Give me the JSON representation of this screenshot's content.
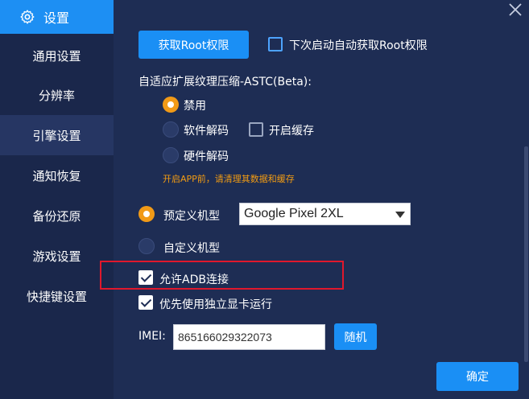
{
  "sidebar": {
    "title": "设置",
    "items": [
      {
        "label": "通用设置"
      },
      {
        "label": "分辨率"
      },
      {
        "label": "引擎设置"
      },
      {
        "label": "通知恢复"
      },
      {
        "label": "备份还原"
      },
      {
        "label": "游戏设置"
      },
      {
        "label": "快捷键设置"
      }
    ],
    "active_item": "引擎设置"
  },
  "root": {
    "button_label": "获取Root权限",
    "auto_checkbox_label": "下次启动自动获取Root权限",
    "auto_checked": false
  },
  "astc": {
    "title": "自适应扩展纹理压缩-ASTC(Beta):",
    "options": [
      {
        "label": "禁用",
        "selected": true
      },
      {
        "label": "软件解码",
        "selected": false
      },
      {
        "label": "硬件解码",
        "selected": false
      }
    ],
    "cache_label": "开启缓存",
    "cache_checked": false,
    "hint": "开启APP前，请清理其数据和缓存"
  },
  "model": {
    "preset_label": "预定义机型",
    "preset_selected": true,
    "preset_value": "Google Pixel 2XL",
    "custom_label": "自定义机型",
    "custom_selected": false
  },
  "adb": {
    "label": "允许ADB连接",
    "checked": true
  },
  "gpu": {
    "label": "优先使用独立显卡运行",
    "checked": true
  },
  "imei": {
    "label": "IMEI:",
    "value": "865166029322073",
    "random_label": "随机"
  },
  "confirm_label": "确定",
  "colors": {
    "accent": "#1a8ff5",
    "radio_selected": "#f19a17",
    "hint": "#f39c12",
    "highlight": "#e0182c",
    "background": "#1e2d54"
  }
}
